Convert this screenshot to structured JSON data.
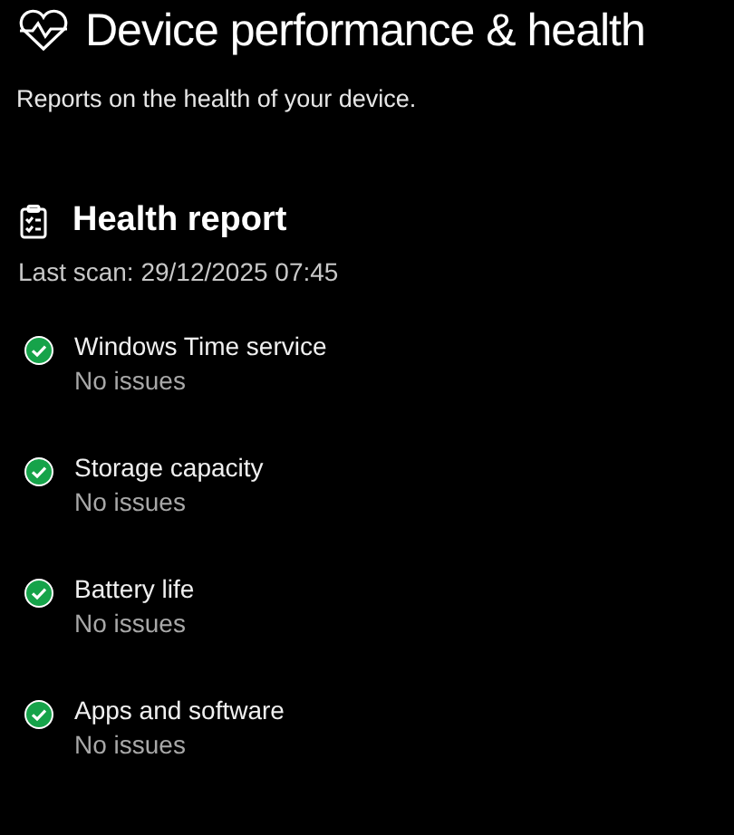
{
  "page": {
    "title": "Device performance & health",
    "subtitle": "Reports on the health of your device."
  },
  "health_report": {
    "title": "Health report",
    "last_scan": "Last scan: 29/12/2025 07:45",
    "items": [
      {
        "name": "Windows Time service",
        "status_text": "No issues",
        "kind": "ok"
      },
      {
        "name": "Storage capacity",
        "status_text": "No issues",
        "kind": "ok"
      },
      {
        "name": "Battery life",
        "status_text": "No issues",
        "kind": "ok"
      },
      {
        "name": "Apps and software",
        "status_text": "No issues",
        "kind": "ok"
      }
    ]
  }
}
